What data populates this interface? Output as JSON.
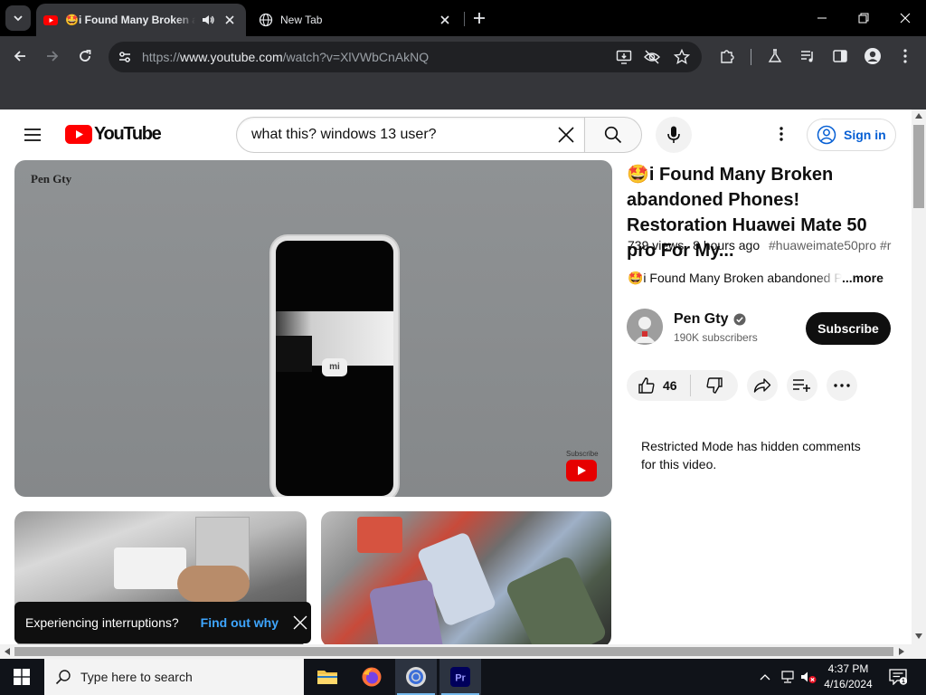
{
  "browser": {
    "tabs": [
      {
        "title": "🤩i Found Many Broken abandoned Phones! Restoration Huawei Mate 50 pro For My...",
        "active": true
      },
      {
        "title": "New Tab",
        "active": false
      }
    ],
    "address": {
      "scheme": "https://",
      "host": "www.youtube.com",
      "path": "/watch?v=XlVWbCnAkNQ"
    }
  },
  "youtube": {
    "logo_text": "YouTube",
    "search_query": "what this? windows 13 user?",
    "sign_in_label": "Sign in",
    "player": {
      "watermark": "Pen Gty",
      "subscribe_label": "Subscribe",
      "phone_logo": "mi"
    },
    "video": {
      "title": "🤩i Found Many Broken abandoned Phones! Restoration Huawei Mate 50 pro For My...",
      "views": "739 views",
      "age": "8 hours ago",
      "tags": "#huaweimate50pro #r",
      "description": "🤩i Found Many Broken abandoned Phones",
      "more_label": "...more"
    },
    "channel": {
      "name": "Pen Gty",
      "subscribers": "190K subscribers",
      "subscribe_label": "Subscribe"
    },
    "likes": "46",
    "comments_notice": "Restricted Mode has hidden comments for this video.",
    "toast": {
      "message": "Experiencing interruptions?",
      "link": "Find out why"
    }
  },
  "taskbar": {
    "search_placeholder": "Type here to search",
    "time": "4:37 PM",
    "date": "4/16/2024",
    "notifications": "1"
  },
  "colors": {
    "youtube_red": "#ff0000",
    "link_blue": "#065fd4",
    "chrome_dark": "#35363a"
  }
}
